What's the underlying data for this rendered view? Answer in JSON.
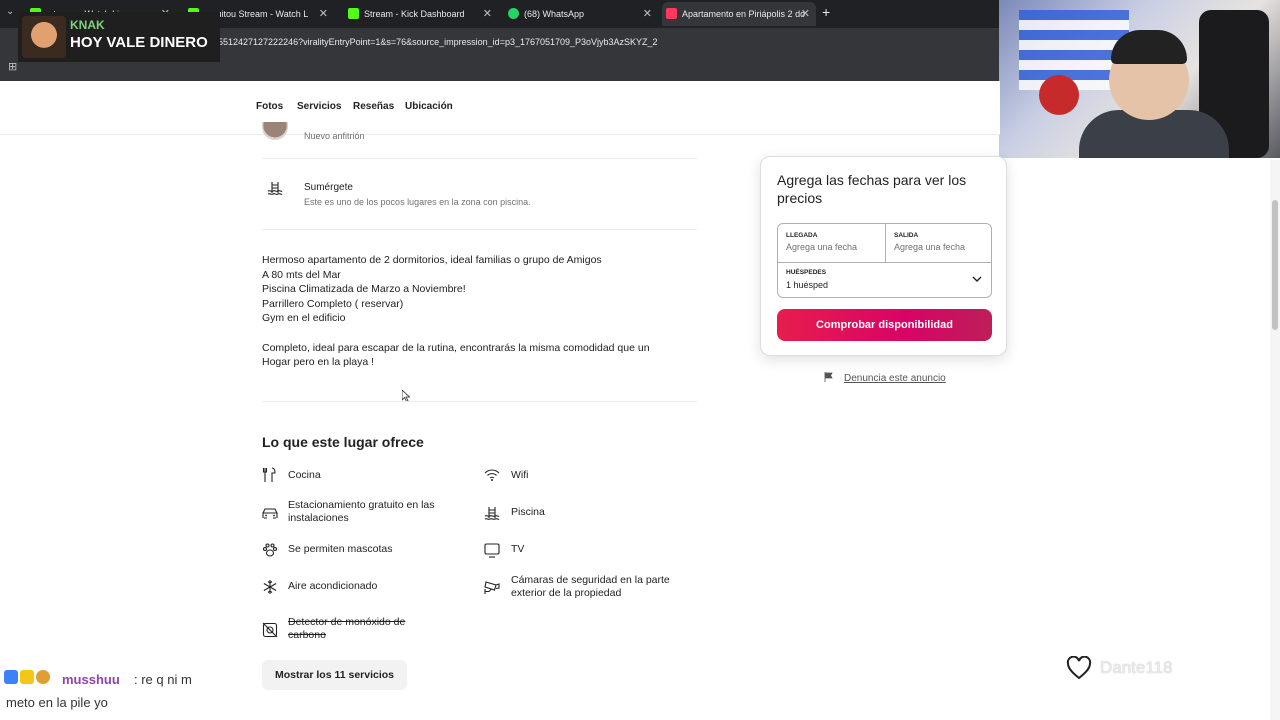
{
  "browser": {
    "tabs": [
      {
        "label": "...tream - Watch Li...",
        "favicon_color": "#53fc18"
      },
      {
        "label": "...quitou Stream - Watch L",
        "favicon_color": "#53fc18"
      },
      {
        "label": "Stream - Kick Dashboard",
        "favicon_color": "#53fc18"
      },
      {
        "label": "(68) WhatsApp",
        "favicon_color": "#25d366"
      },
      {
        "label": "Apartamento en Piriápolis 2 do",
        "favicon_color": "#ff385c"
      }
    ],
    "url": "5512427127222246?viralityEntryPoint=1&s=76&source_impression_id=p3_1767051709_P3oVjyb3AzSKYZ_2"
  },
  "overlay": {
    "knak_name": "KNAK",
    "knak_message": "HOY VALE DINERO"
  },
  "subnav": {
    "items": [
      "Fotos",
      "Servicios",
      "Reseñas",
      "Ubicación"
    ]
  },
  "host": {
    "subtitle": "Nuevo anfitrión"
  },
  "highlight": {
    "title": "Sumérgete",
    "description": "Este es uno de los pocos lugares en la zona con piscina."
  },
  "description": {
    "lines": [
      "Hermoso apartamento de 2 dormitorios, ideal familias o grupo de Amigos",
      "A 80 mts del Mar",
      "Piscina Climatizada de Marzo a Noviembre!",
      "Parrillero Completo ( reservar)",
      "Gym en el edificio",
      "",
      "Completo, ideal para escapar  de la rutina, encontrarás la misma comodidad que un",
      "Hogar pero en la playa !"
    ]
  },
  "amenities": {
    "title": "Lo que este lugar ofrece",
    "items": [
      {
        "label": "Cocina",
        "icon": "utensils-icon"
      },
      {
        "label": "Wifi",
        "icon": "wifi-icon"
      },
      {
        "label": "Estacionamiento gratuito en las instalaciones",
        "icon": "car-icon"
      },
      {
        "label": "Piscina",
        "icon": "pool-icon"
      },
      {
        "label": "Se permiten mascotas",
        "icon": "paw-icon"
      },
      {
        "label": "TV",
        "icon": "tv-icon"
      },
      {
        "label": "Aire acondicionado",
        "icon": "snowflake-icon"
      },
      {
        "label": "Cámaras de seguridad en la parte exterior de la propiedad",
        "icon": "camera-icon"
      },
      {
        "label": "Detector de monóxido de carbono",
        "icon": "co-detector-icon",
        "unavailable": true
      }
    ],
    "show_all_label": "Mostrar los 11 servicios"
  },
  "booking": {
    "title": "Agrega las fechas para ver los precios",
    "checkin_label": "LLEGADA",
    "checkin_placeholder": "Agrega una fecha",
    "checkout_label": "SALIDA",
    "checkout_placeholder": "Agrega una fecha",
    "guests_label": "HUÉSPEDES",
    "guests_value": "1 huésped",
    "button_label": "Comprobar disponibilidad",
    "accent_color": "#e61e4d"
  },
  "report": {
    "label": "Denuncia este anuncio"
  },
  "chat": {
    "user": "musshuu",
    "message_line1": ": re q ni m",
    "message_line2": "meto en la pile yo"
  },
  "heart_widget": {
    "text": "Dante118"
  }
}
